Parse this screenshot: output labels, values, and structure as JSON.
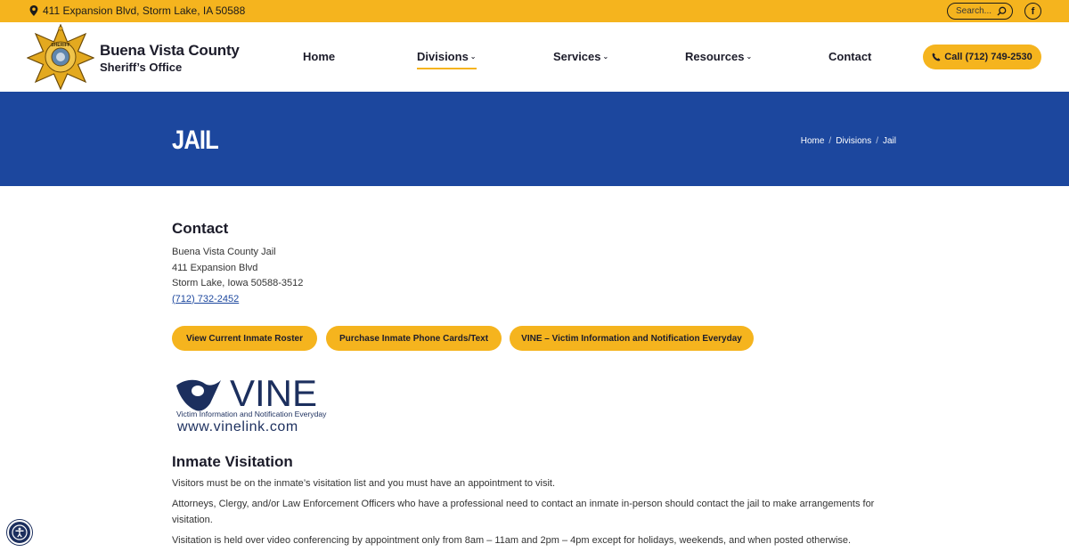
{
  "topbar": {
    "address": "411 Expansion Blvd, Storm Lake, IA 50588",
    "search_placeholder": "Search...",
    "facebook_label": "f"
  },
  "brand": {
    "line1": "Buena Vista County",
    "line2": "Sheriff’s Office",
    "badge_text_top": "SHERIFF",
    "badge_text_bottom": "BUENA VISTA COUNTY"
  },
  "nav": {
    "items": [
      {
        "label": "Home",
        "dropdown": false,
        "active": false
      },
      {
        "label": "Divisions",
        "dropdown": true,
        "active": true
      },
      {
        "label": "Services",
        "dropdown": true,
        "active": false
      },
      {
        "label": "Resources",
        "dropdown": true,
        "active": false
      },
      {
        "label": "Contact",
        "dropdown": false,
        "active": false
      }
    ],
    "call_label": "Call (712) 749-2530"
  },
  "page": {
    "title": "JAIL",
    "breadcrumbs": [
      "Home",
      "Divisions",
      "Jail"
    ]
  },
  "contact": {
    "heading": "Contact",
    "lines": [
      "Buena Vista County Jail",
      "411 Expansion Blvd",
      "Storm Lake, Iowa 50588-3512"
    ],
    "phone": "(712) 732-2452"
  },
  "buttons": [
    "View Current Inmate Roster",
    "Purchase Inmate Phone Cards/Text",
    "VINE – Victim Information and Notification Everyday"
  ],
  "vine": {
    "wordmark": "VINE",
    "tagline": "Victim Information and Notification Everyday",
    "url": "www.vinelink.com"
  },
  "visitation": {
    "heading": "Inmate Visitation",
    "paragraphs": [
      "Visitors must be on the inmate’s visitation list and you must have an appointment to visit.",
      "Attorneys, Clergy, and/or Law Enforcement Officers who have a professional need to contact an inmate in-person should contact the jail to make arrangements for visitation.",
      "Visitation is held over video conferencing by appointment only from 8am – 11am and 2pm – 4pm except for holidays, weekends, and when posted otherwise."
    ]
  },
  "colors": {
    "accent": "#f5b41e",
    "title_bar": "#1c479e",
    "text_dark": "#1c1c2a"
  }
}
